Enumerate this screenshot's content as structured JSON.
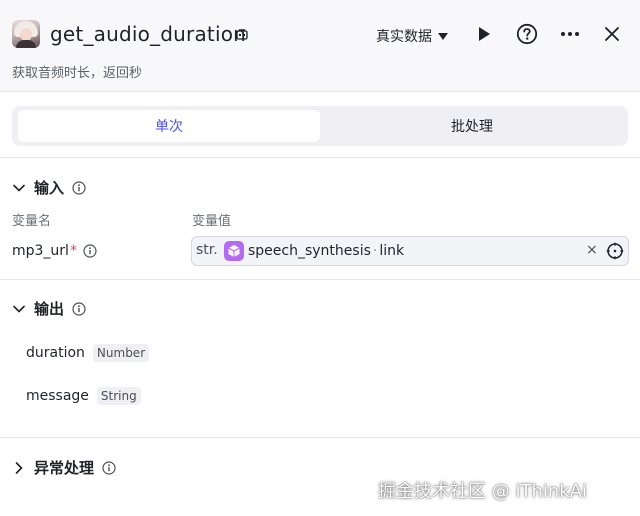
{
  "header": {
    "title": "get_audio_duration",
    "subtitle": "获取音频时长，返回秒",
    "data_mode": "真实数据"
  },
  "tabs": [
    {
      "label": "单次",
      "active": true
    },
    {
      "label": "批处理",
      "active": false
    }
  ],
  "input": {
    "section_label": "输入",
    "col_name": "变量名",
    "col_value": "变量值",
    "var_name": "mp3_url",
    "required_mark": "*",
    "type_tag": "str.",
    "ref_node": "speech_synthesis",
    "ref_sep": "·",
    "ref_field": "link",
    "clear": "×"
  },
  "output": {
    "section_label": "输出",
    "fields": [
      {
        "name": "duration",
        "type": "Number"
      },
      {
        "name": "message",
        "type": "String"
      }
    ]
  },
  "exception": {
    "section_label": "异常处理"
  },
  "watermark": "掘金技术社区 @ iThinkAi",
  "colors": {
    "accent": "#4d53e8",
    "required": "#e5484d",
    "node_icon": "#b36bf0"
  }
}
